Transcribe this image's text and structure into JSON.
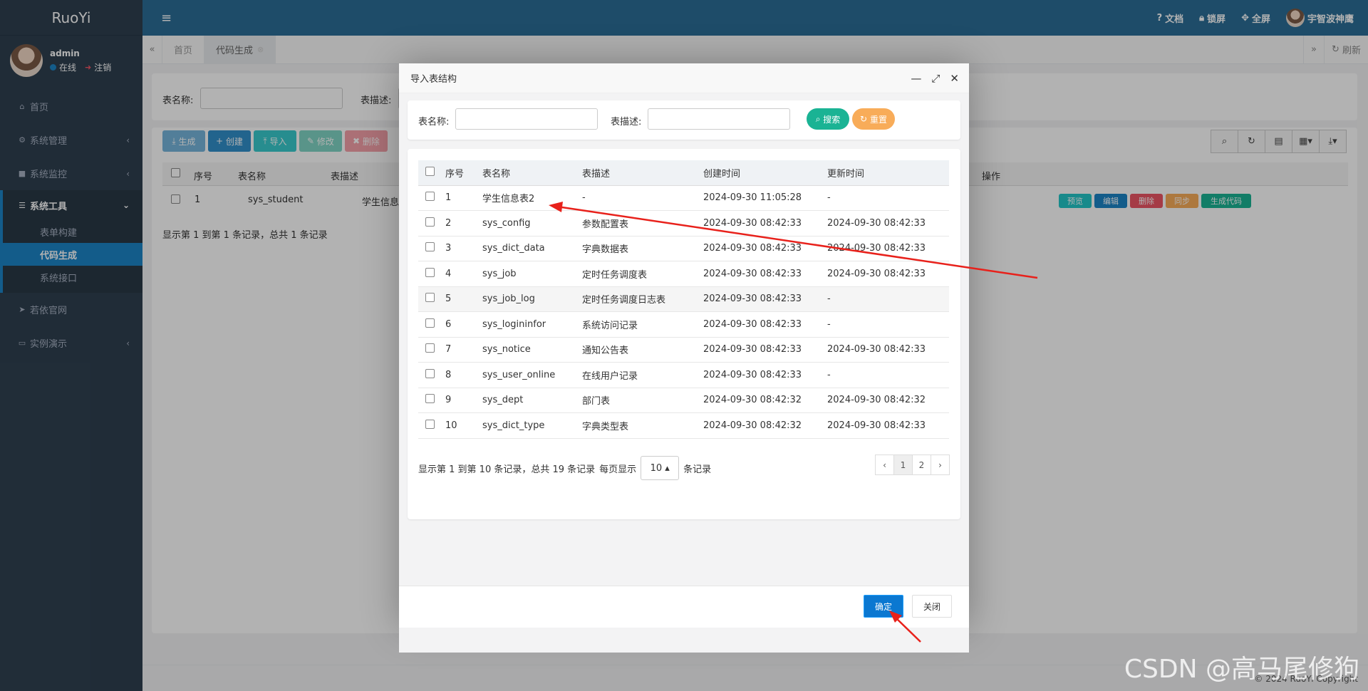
{
  "app": {
    "logo": "RuoYi"
  },
  "user": {
    "name": "admin",
    "status": "在线",
    "logout": "注销"
  },
  "top_bar": {
    "docs": "文档",
    "lock": "锁屏",
    "fullscreen": "全屏",
    "username": "宇智波神鹰"
  },
  "sidebar": {
    "items": [
      {
        "label": "首页",
        "icon": "home-icon"
      },
      {
        "label": "系统管理",
        "icon": "gear-icon"
      },
      {
        "label": "系统监控",
        "icon": "video-icon"
      },
      {
        "label": "系统工具",
        "icon": "bars-icon"
      },
      {
        "label": "若依官网",
        "icon": "send-icon"
      },
      {
        "label": "实例演示",
        "icon": "desktop-icon"
      }
    ],
    "sub_items": [
      "表单构建",
      "代码生成",
      "系统接口"
    ]
  },
  "tabs": {
    "home": "首页",
    "current": "代码生成",
    "refresh": "刷新"
  },
  "background": {
    "search": {
      "table_name_label": "表名称:",
      "table_desc_label": "表描述:"
    },
    "toolbar": {
      "generate": "生成",
      "create": "创建",
      "import": "导入",
      "edit": "修改",
      "delete": "删除"
    },
    "columns": [
      "序号",
      "表名称",
      "表描述",
      "操作"
    ],
    "row": {
      "index": "1",
      "name": "sys_student",
      "desc": "学生信息"
    },
    "row_ops": [
      "预览",
      "编辑",
      "删除",
      "同步",
      "生成代码"
    ],
    "summary": "显示第 1 到第 1 条记录，总共 1 条记录",
    "footer": "© 2024 RuoYi Copyright"
  },
  "modal": {
    "title": "导入表结构",
    "search": {
      "table_name_label": "表名称:",
      "table_desc_label": "表描述:",
      "search_btn": "搜索",
      "reset_btn": "重置"
    },
    "columns": [
      "序号",
      "表名称",
      "表描述",
      "创建时间",
      "更新时间"
    ],
    "rows": [
      [
        "1",
        "学生信息表2",
        "-",
        "2024-09-30 11:05:28",
        "-"
      ],
      [
        "2",
        "sys_config",
        "参数配置表",
        "2024-09-30 08:42:33",
        "2024-09-30 08:42:33"
      ],
      [
        "3",
        "sys_dict_data",
        "字典数据表",
        "2024-09-30 08:42:33",
        "2024-09-30 08:42:33"
      ],
      [
        "4",
        "sys_job",
        "定时任务调度表",
        "2024-09-30 08:42:33",
        "2024-09-30 08:42:33"
      ],
      [
        "5",
        "sys_job_log",
        "定时任务调度日志表",
        "2024-09-30 08:42:33",
        "-"
      ],
      [
        "6",
        "sys_logininfor",
        "系统访问记录",
        "2024-09-30 08:42:33",
        "-"
      ],
      [
        "7",
        "sys_notice",
        "通知公告表",
        "2024-09-30 08:42:33",
        "2024-09-30 08:42:33"
      ],
      [
        "8",
        "sys_user_online",
        "在线用户记录",
        "2024-09-30 08:42:33",
        "-"
      ],
      [
        "9",
        "sys_dept",
        "部门表",
        "2024-09-30 08:42:32",
        "2024-09-30 08:42:32"
      ],
      [
        "10",
        "sys_dict_type",
        "字典类型表",
        "2024-09-30 08:42:32",
        "2024-09-30 08:42:33"
      ]
    ],
    "pager": {
      "info": "显示第 1 到第 10 条记录，总共 19 条记录",
      "per_page_prefix": "每页显示",
      "page_size": "10",
      "per_page_suffix": "条记录",
      "prev": "‹",
      "pages": [
        "1",
        "2"
      ],
      "next": "›"
    },
    "ok": "确定",
    "close": "关闭"
  },
  "watermark": "CSDN @高马尾修狗",
  "colors": {
    "sidebar": "#2f4050",
    "topbar": "#2b6e97",
    "accent": "#1c84c6",
    "arrow": "#e8211b"
  }
}
